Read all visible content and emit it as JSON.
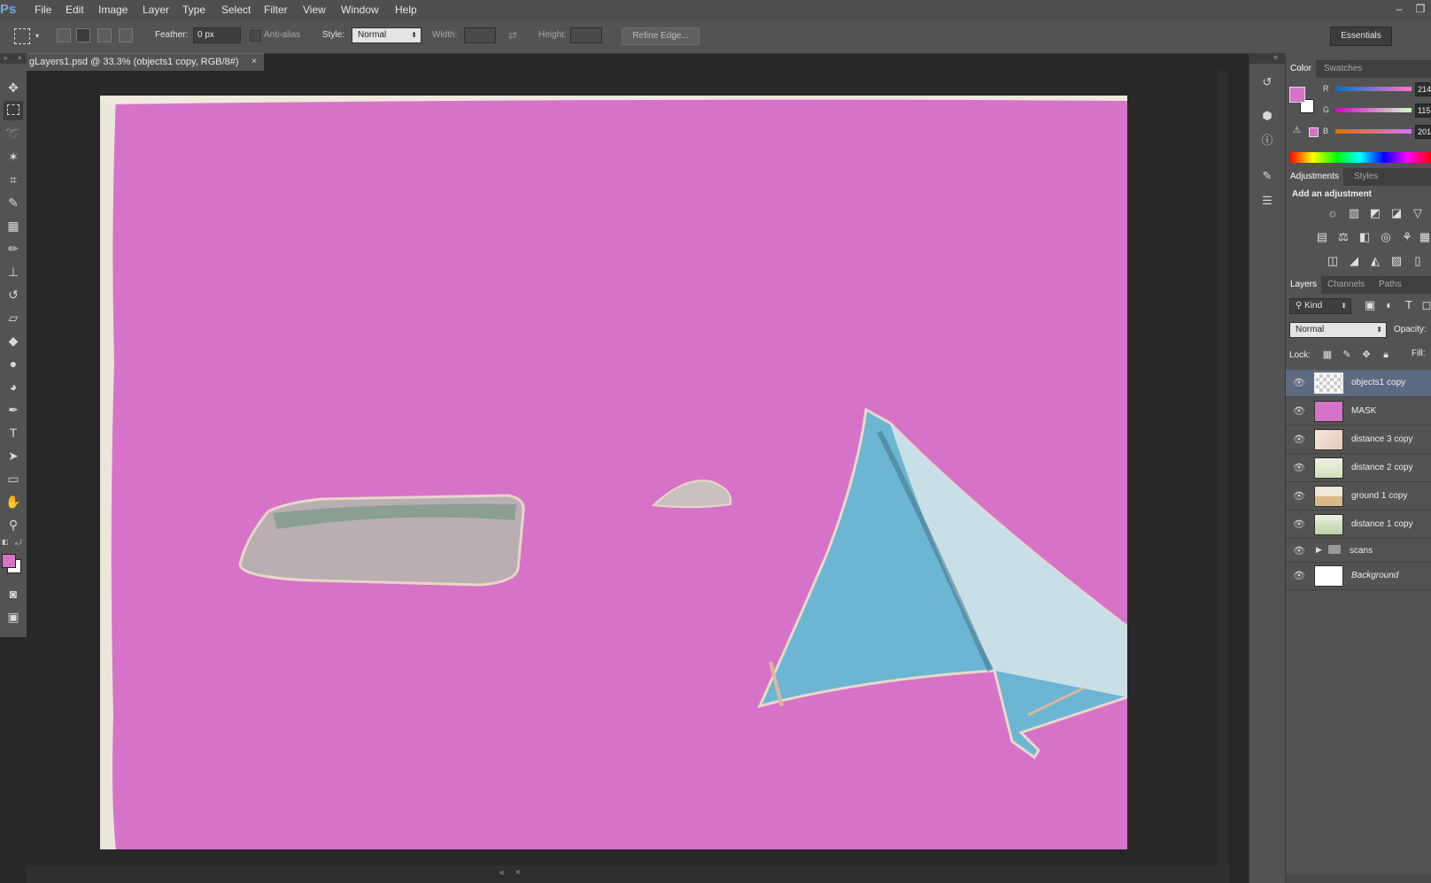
{
  "app": {
    "logo": "Ps"
  },
  "menubar": {
    "items": [
      "File",
      "Edit",
      "Image",
      "Layer",
      "Type",
      "Select",
      "Filter",
      "View",
      "Window",
      "Help"
    ],
    "minimize": "–",
    "restore": "❐"
  },
  "options": {
    "feather_label": "Feather:",
    "feather_value": "0 px",
    "antialias_label": "Anti-alias",
    "style_label": "Style:",
    "style_value": "Normal",
    "width_label": "Width:",
    "height_label": "Height:",
    "refine_label": "Refine Edge...",
    "workspace": "Essentials"
  },
  "document": {
    "tab_title": "gLayers1.psd @ 33.3% (objects1 copy, RGB/8#)",
    "close": "×"
  },
  "colors": {
    "foreground": "#d673c9",
    "background": "#ffffff",
    "canvas": "#d673c9",
    "selected_layer": "#5d6b81"
  },
  "color_panel": {
    "tabs": [
      "Color",
      "Swatches"
    ],
    "r_label": "R",
    "r_value": "214",
    "g_label": "G",
    "g_value": "115",
    "b_label": "B",
    "b_value": "201"
  },
  "adjustments_panel": {
    "tabs": [
      "Adjustments",
      "Styles"
    ],
    "heading": "Add an adjustment"
  },
  "layers_panel": {
    "tabs": [
      "Layers",
      "Channels",
      "Paths"
    ],
    "kind_label": "Kind",
    "blend_mode": "Normal",
    "opacity_label": "Opacity:",
    "lock_label": "Lock:",
    "fill_label": "Fill:",
    "layers": [
      {
        "name": "objects1 copy",
        "selected": true
      },
      {
        "name": "MASK"
      },
      {
        "name": "distance 3 copy"
      },
      {
        "name": "distance 2 copy"
      },
      {
        "name": "ground 1 copy"
      },
      {
        "name": "distance 1 copy"
      },
      {
        "name": "scans",
        "group": true
      },
      {
        "name": "Background",
        "italic": true
      }
    ]
  }
}
